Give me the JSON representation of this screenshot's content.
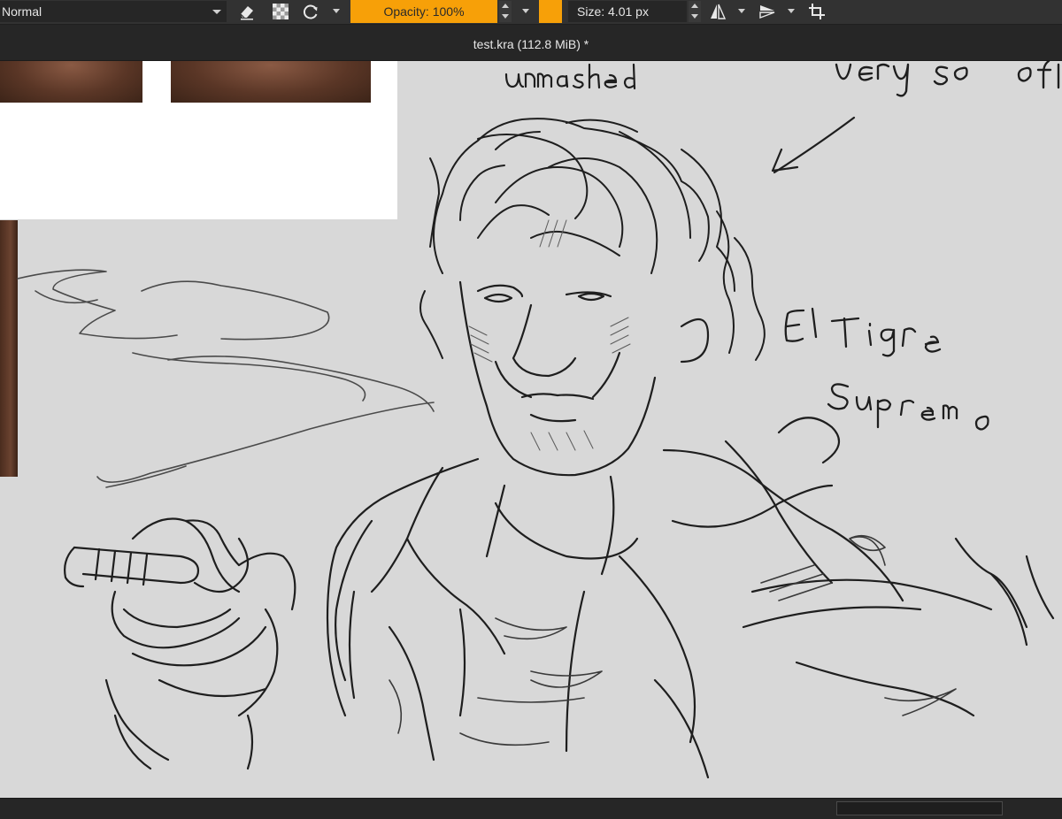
{
  "toolbar": {
    "blend_mode": "Normal",
    "opacity_label": "Opacity: 100%",
    "size_label": "Size: 4.01 px",
    "icons": [
      "eraser-icon",
      "alpha-lock-icon",
      "reload-preset-icon",
      "mirror-horizontal-icon",
      "mirror-vertical-icon",
      "wrap-around-icon"
    ],
    "accent_color": "#f7a008"
  },
  "document": {
    "title": "test.kra (112.8 MiB) *"
  },
  "canvas": {
    "background_color": "#d8d8d8",
    "annotations": [
      "unmasked",
      "very so oft",
      "El Tigre",
      "Supremo"
    ]
  }
}
